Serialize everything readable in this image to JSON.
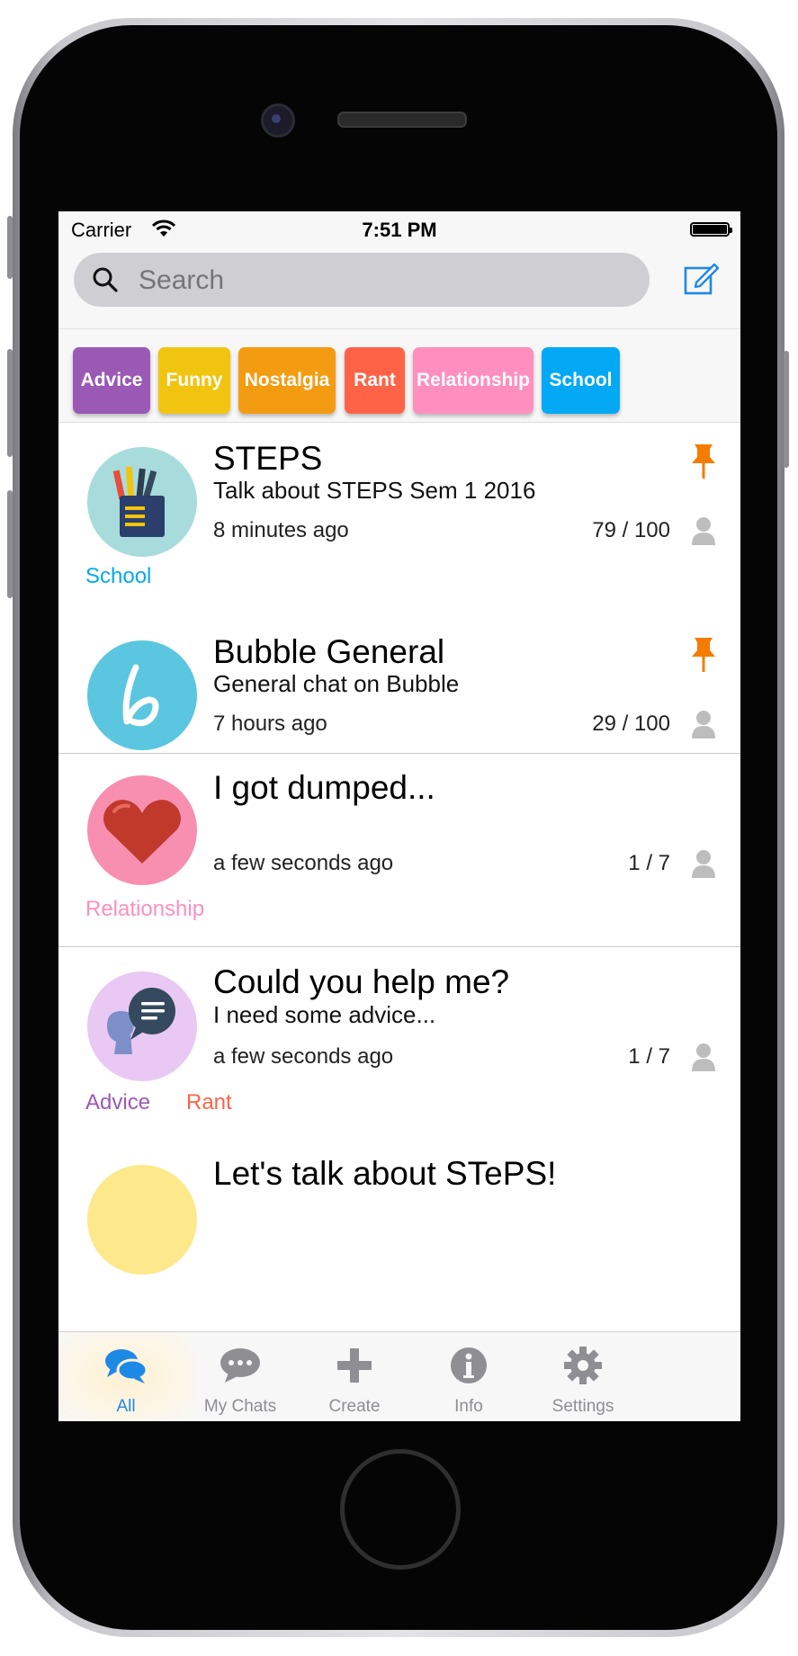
{
  "status_bar": {
    "carrier": "Carrier",
    "time": "7:51 PM"
  },
  "search": {
    "placeholder": "Search"
  },
  "categories": [
    {
      "label": "Advice",
      "color": "#9b59b6"
    },
    {
      "label": "Funny",
      "color": "#f1c40f"
    },
    {
      "label": "Nostalgia",
      "color": "#f39c12"
    },
    {
      "label": "Rant",
      "color": "#ff6347"
    },
    {
      "label": "Relationship",
      "color": "#ff8fbf"
    },
    {
      "label": "School",
      "color": "#03a9f4"
    }
  ],
  "chats": [
    {
      "title": "STEPS",
      "subtitle": "Talk about STEPS Sem 1 2016",
      "time": "8 minutes ago",
      "count": "79 / 100",
      "pinned": true,
      "icon": "pencil-cup-icon",
      "tags": [
        {
          "label": "School",
          "color": "#03a9f4"
        }
      ]
    },
    {
      "title": "Bubble General",
      "subtitle": "General chat on Bubble",
      "time": "7 hours ago",
      "count": "29 / 100",
      "pinned": true,
      "icon": "bubble-logo-icon",
      "tags": []
    },
    {
      "title": "I got dumped...",
      "subtitle": "",
      "time": "a few seconds ago",
      "count": "1 / 7",
      "pinned": false,
      "icon": "heart-icon",
      "tags": [
        {
          "label": "Relationship",
          "color": "#ff8fbf"
        }
      ]
    },
    {
      "title": "Could you help me?",
      "subtitle": "I need some advice...",
      "time": "a few seconds ago",
      "count": "1 / 7",
      "pinned": false,
      "icon": "advice-speech-icon",
      "tags": [
        {
          "label": "Advice",
          "color": "#9b59b6"
        },
        {
          "label": "Rant",
          "color": "#ff6347"
        }
      ]
    },
    {
      "title": "Let's talk about STePS!",
      "subtitle": "",
      "time": "",
      "count": "",
      "pinned": false,
      "icon": "partial-avatar-icon",
      "tags": []
    }
  ],
  "tabbar": {
    "active": "All",
    "tabs": [
      {
        "label": "All",
        "icon": "chat-bubbles-icon"
      },
      {
        "label": "My Chats",
        "icon": "speech-bubble-icon"
      },
      {
        "label": "Create",
        "icon": "plus-icon"
      },
      {
        "label": "Info",
        "icon": "info-icon"
      },
      {
        "label": "Settings",
        "icon": "gear-icon"
      }
    ],
    "active_color": "#1e88e5",
    "inactive_color": "#8e8e93"
  }
}
